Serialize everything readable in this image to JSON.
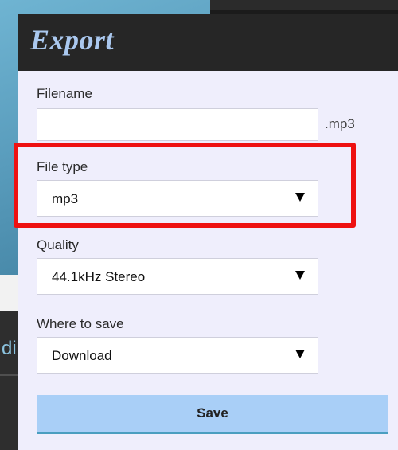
{
  "background": {
    "tab_fragment": "di"
  },
  "dialog": {
    "title": "Export",
    "filename": {
      "label": "Filename",
      "value": "",
      "placeholder": "",
      "suffix": ".mp3"
    },
    "file_type": {
      "label": "File type",
      "selected": "mp3"
    },
    "quality": {
      "label": "Quality",
      "selected": "44.1kHz Stereo"
    },
    "where_to_save": {
      "label": "Where to save",
      "selected": "Download"
    },
    "save_label": "Save"
  },
  "colors": {
    "header": "#262626",
    "title": "#aac8ef",
    "dialog_bg": "#efeefc",
    "button": "#a9cff7",
    "highlight": "#ee1111"
  },
  "icons": {
    "dropdown": "caret-down-icon"
  }
}
